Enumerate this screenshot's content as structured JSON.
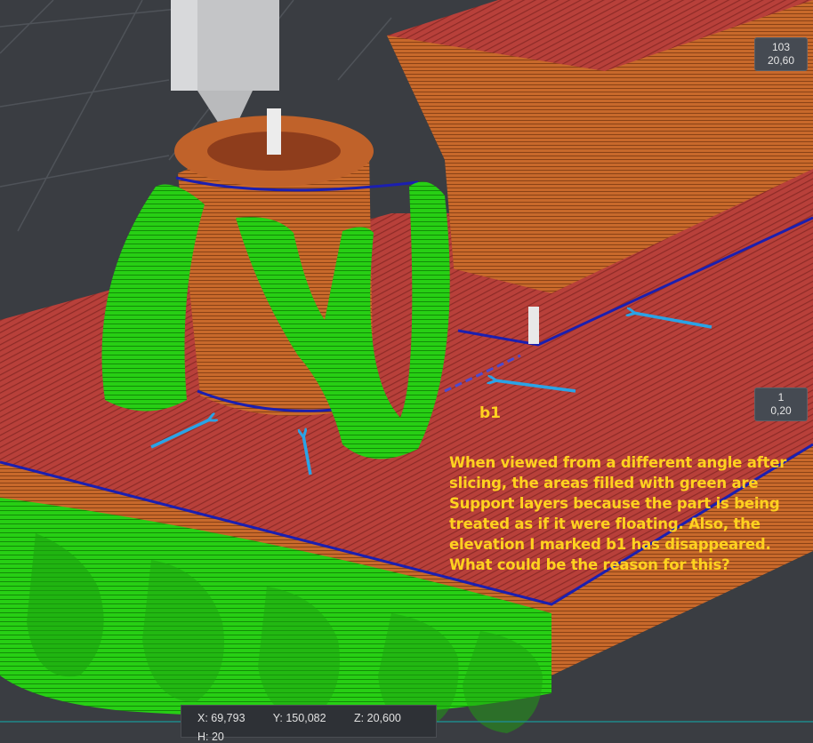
{
  "layer_slider": {
    "top": {
      "layer": "103",
      "height": "20,60"
    },
    "bottom": {
      "layer": "1",
      "height": "0,20"
    }
  },
  "annotation": {
    "marker_label": "b1",
    "note": "When viewed from a different angle after slicing, the areas filled with green are Support layers because the part is being treated as if it were floating. Also, the elevation I marked b1 has disappeared. What could be the reason for this?"
  },
  "coordinates": {
    "x": "X: 69,793",
    "y": "Y: 150,082",
    "z": "Z: 20,600",
    "partial": "H: 20"
  },
  "colors": {
    "support": "#21c80f",
    "perimeter": "#c86a2a",
    "top_solid_infill": "#b33a34",
    "wipe_line": "#1b1fb0",
    "arrow": "#2aa3e6",
    "note_text": "#ffd21f"
  }
}
